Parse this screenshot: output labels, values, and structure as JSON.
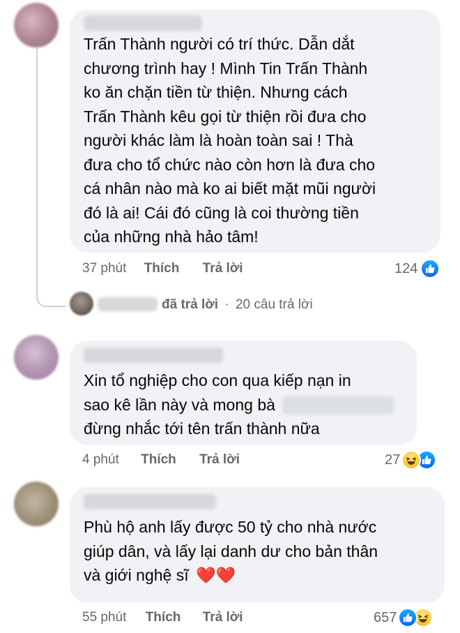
{
  "comments": [
    {
      "lines": [
        "Trấn Thành người có trí thức. Dẫn dắt",
        "chương trình hay ! Mình Tin Trấn Thành",
        "ko ăn chặn tiền từ thiện. Nhưng cách",
        "Trấn Thành kêu gọi từ thiện rồi đưa cho",
        "người khác làm là hoàn toàn sai ! Thà",
        "đưa cho tổ chức nào còn hơn là đưa cho",
        "cá nhân nào mà ko ai biết mặt mũi người",
        "đó là ai! Cái đó cũng là coi thường tiền",
        "của những nhà hảo tâm!"
      ],
      "time": "37 phút",
      "like": "Thích",
      "reply": "Trả lời",
      "reactions": "124",
      "reaction_icons": [
        "like-icon"
      ]
    },
    {
      "line1": "Xin tổ nghiệp cho con qua kiếp nạn in",
      "line2_prefix": "sao kê lần này và mong bà",
      "line3": "đừng nhắc tới tên trấn thành nữa",
      "time": "4 phút",
      "like": "Thích",
      "reply": "Trả lời",
      "reactions": "27",
      "reaction_icons": [
        "haha-icon",
        "like-icon"
      ]
    },
    {
      "line1": "Phù hộ anh lấy được 50 tỷ cho nhà nước",
      "line2": "giúp dân, và lấy lại danh dư cho bản thân",
      "line3": "và giới nghệ sĩ",
      "hearts": "❤️❤️",
      "time": "55 phút",
      "like": "Thích",
      "reply": "Trả lời",
      "reactions": "657",
      "reaction_icons": [
        "like-icon",
        "haha-icon"
      ]
    }
  ],
  "replies_summary": {
    "text": "đã trả lời",
    "separator": "·",
    "count_text": "20 câu trả lời"
  },
  "colors": {
    "bubble": "#f0f2f5",
    "meta_text": "#65676b",
    "like_blue": "#0866ff",
    "connector": "#ccd0d5"
  }
}
